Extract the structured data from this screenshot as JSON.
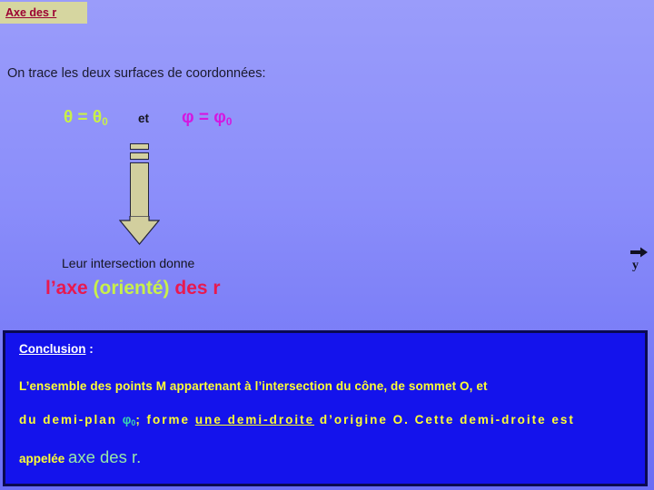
{
  "slide": {
    "title_badge": "Axe des r",
    "intro": "On trace les deux surfaces de coordonnées:",
    "equations": {
      "theta": "θ = θ",
      "theta_sub": "0",
      "connector": "et",
      "phi": "φ = φ",
      "phi_sub": "0"
    },
    "intersection_text": "Leur intersection donne",
    "result": {
      "part1": "l’axe ",
      "part2": "(orienté)",
      "part3": " des r"
    },
    "axis_marker": {
      "label": "y",
      "icon": "right-arrow-icon"
    },
    "arrow": {
      "icon": "down-arrow-icon"
    },
    "conclusion": {
      "heading": "Conclusion",
      "heading_colon": " :",
      "line1": "L’ensemble des points M appartenant à l’intersection du cône, de sommet O, et",
      "line2": {
        "before": "du  demi-plan  ",
        "phi": "φ",
        "phi_sub": "0",
        "mid": ";  forme  ",
        "underlined": "une  demi-droite",
        "after": "  d’origine  O.  Cette  demi-droite    est"
      },
      "line3": {
        "small": "appelée ",
        "big": "axe des r."
      }
    },
    "colors": {
      "background_top": "#9a9cfa",
      "background_bottom": "#6a6df5",
      "badge_bg": "#d6d6a0",
      "badge_text": "#9c0032",
      "theta_color": "#c8f04a",
      "phi_color": "#d417e0",
      "arrow_fill": "#d2cf9e",
      "arrow_stroke": "#23233a",
      "result_crimson": "#e8194f",
      "result_green": "#c8f04a",
      "conclusion_bg": "#1413ec",
      "conclusion_border": "#0a0a52",
      "conclusion_text": "#ffff33",
      "conclusion_heading": "#ffffff",
      "conclusion_phi": "#3ad6b0",
      "conclusion_axis_text": "#96e6a8"
    }
  }
}
